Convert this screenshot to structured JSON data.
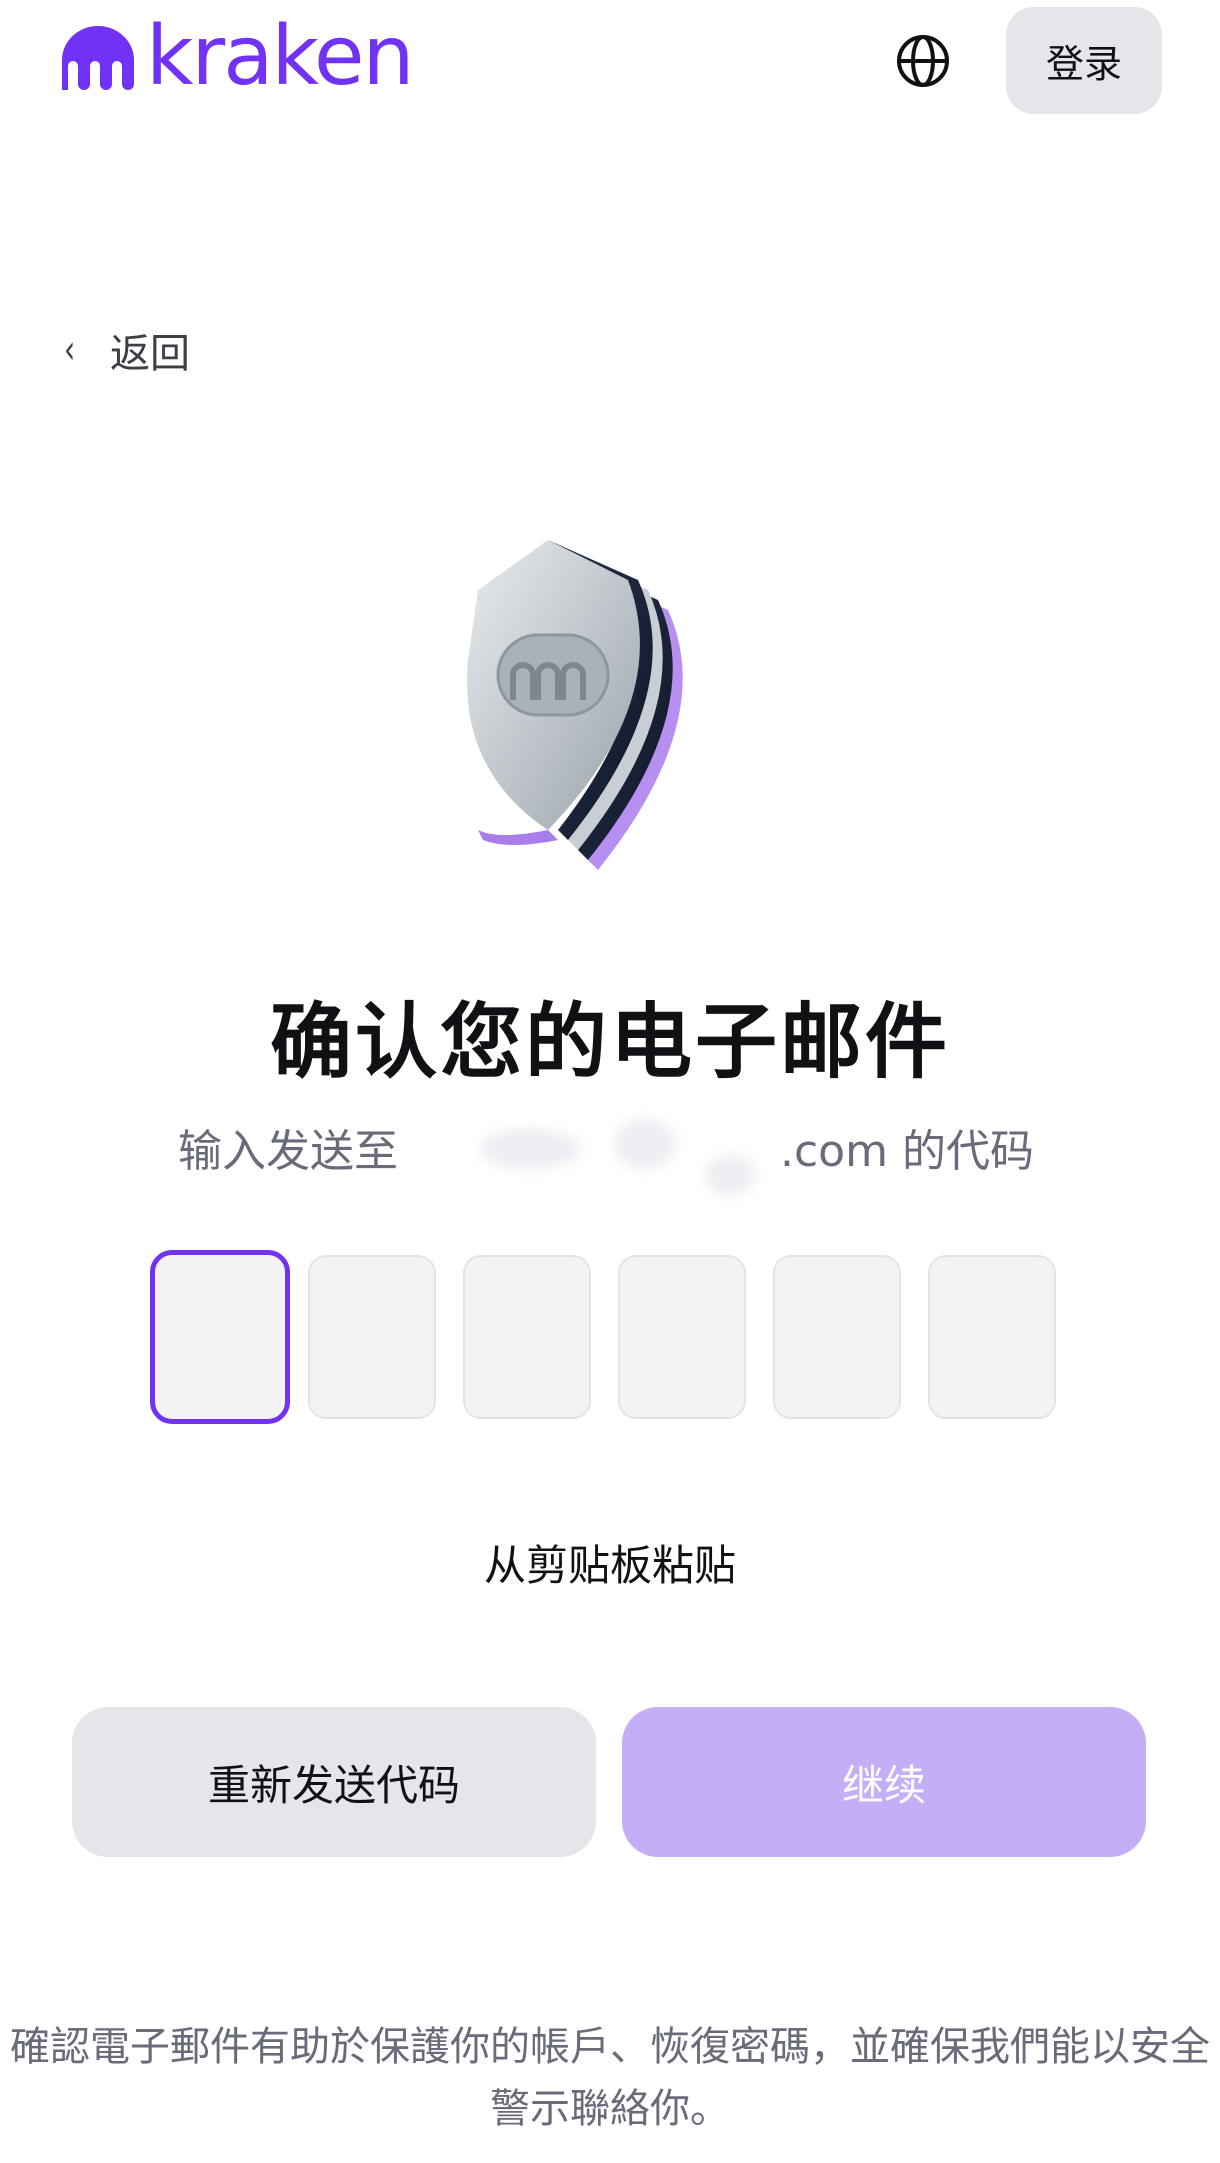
{
  "brand": {
    "name": "kraken",
    "color": "#7132f5"
  },
  "header": {
    "language_icon": "globe-icon",
    "login_label": "登录"
  },
  "nav": {
    "back_icon": "chevron-left-icon",
    "back_label": "返回"
  },
  "hero": {
    "illustration": "kraken-shield-illustration"
  },
  "verify": {
    "title": "确认您的电子邮件",
    "subtitle_prefix": "输入发送至",
    "subtitle_suffix": ".com 的代码",
    "code_length": 6,
    "code_digits": [
      "",
      "",
      "",
      "",
      "",
      ""
    ],
    "paste_label": "从剪贴板粘贴",
    "resend_label": "重新发送代码",
    "continue_label": "继续",
    "continue_enabled": false
  },
  "footer": {
    "note": "確認電子郵件有助於保護你的帳戶、恢復密碼，並確保我們能以安全警示聯絡你。"
  }
}
